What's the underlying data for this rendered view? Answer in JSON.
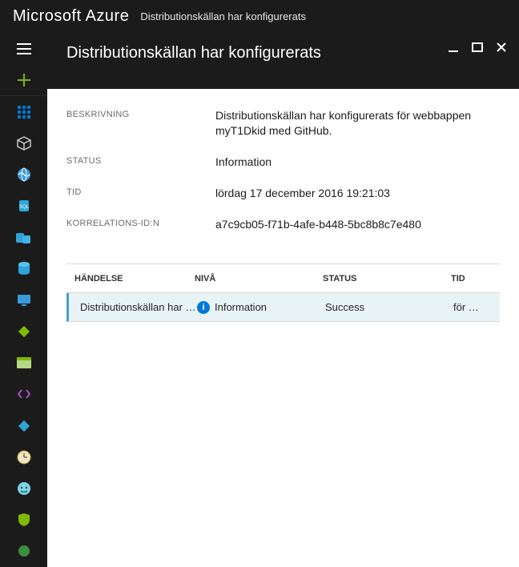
{
  "topbar": {
    "brand": "Microsoft Azure",
    "breadcrumb": "Distributionskällan har konfigurerats"
  },
  "blade": {
    "title": "Distributionskällan har konfigurerats"
  },
  "details": {
    "labels": {
      "beskrivning": "BESKRIVNING",
      "status": "STATUS",
      "tid": "TID",
      "korrelation": "KORRELATIONS-ID:N"
    },
    "values": {
      "beskrivning": "Distributionskällan har konfigurerats för webbappen myT1Dkid med GitHub.",
      "status": "Information",
      "tid": "lördag 17 december 2016 19:21:03",
      "korrelation": "a7c9cb05-f71b-4afe-b448-5bc8b8c7e480"
    }
  },
  "events": {
    "headers": {
      "handelse": "HÄNDELSE",
      "niva": "NIVÅ",
      "status": "STATUS",
      "tid": "TID"
    },
    "row": {
      "handelse": "Distributionskällan har k…",
      "niva": "Information",
      "status": "Success",
      "tid": "för …"
    }
  },
  "icons": {
    "hamburger": "hamburger-icon",
    "plus": "plus-icon",
    "grid": "apps-grid-icon",
    "cube": "cube-icon",
    "globe": "globe-icon",
    "sql": "sql-icon",
    "sqlpool": "sql-pool-icon",
    "db": "database-icon",
    "vm": "vm-icon",
    "diamond": "diamond-green-icon",
    "card": "card-icon",
    "code": "code-icon",
    "diamond2": "diamond-blue-icon",
    "clock": "clock-icon",
    "face": "face-icon",
    "shield": "shield-icon",
    "circle": "circle-icon"
  }
}
